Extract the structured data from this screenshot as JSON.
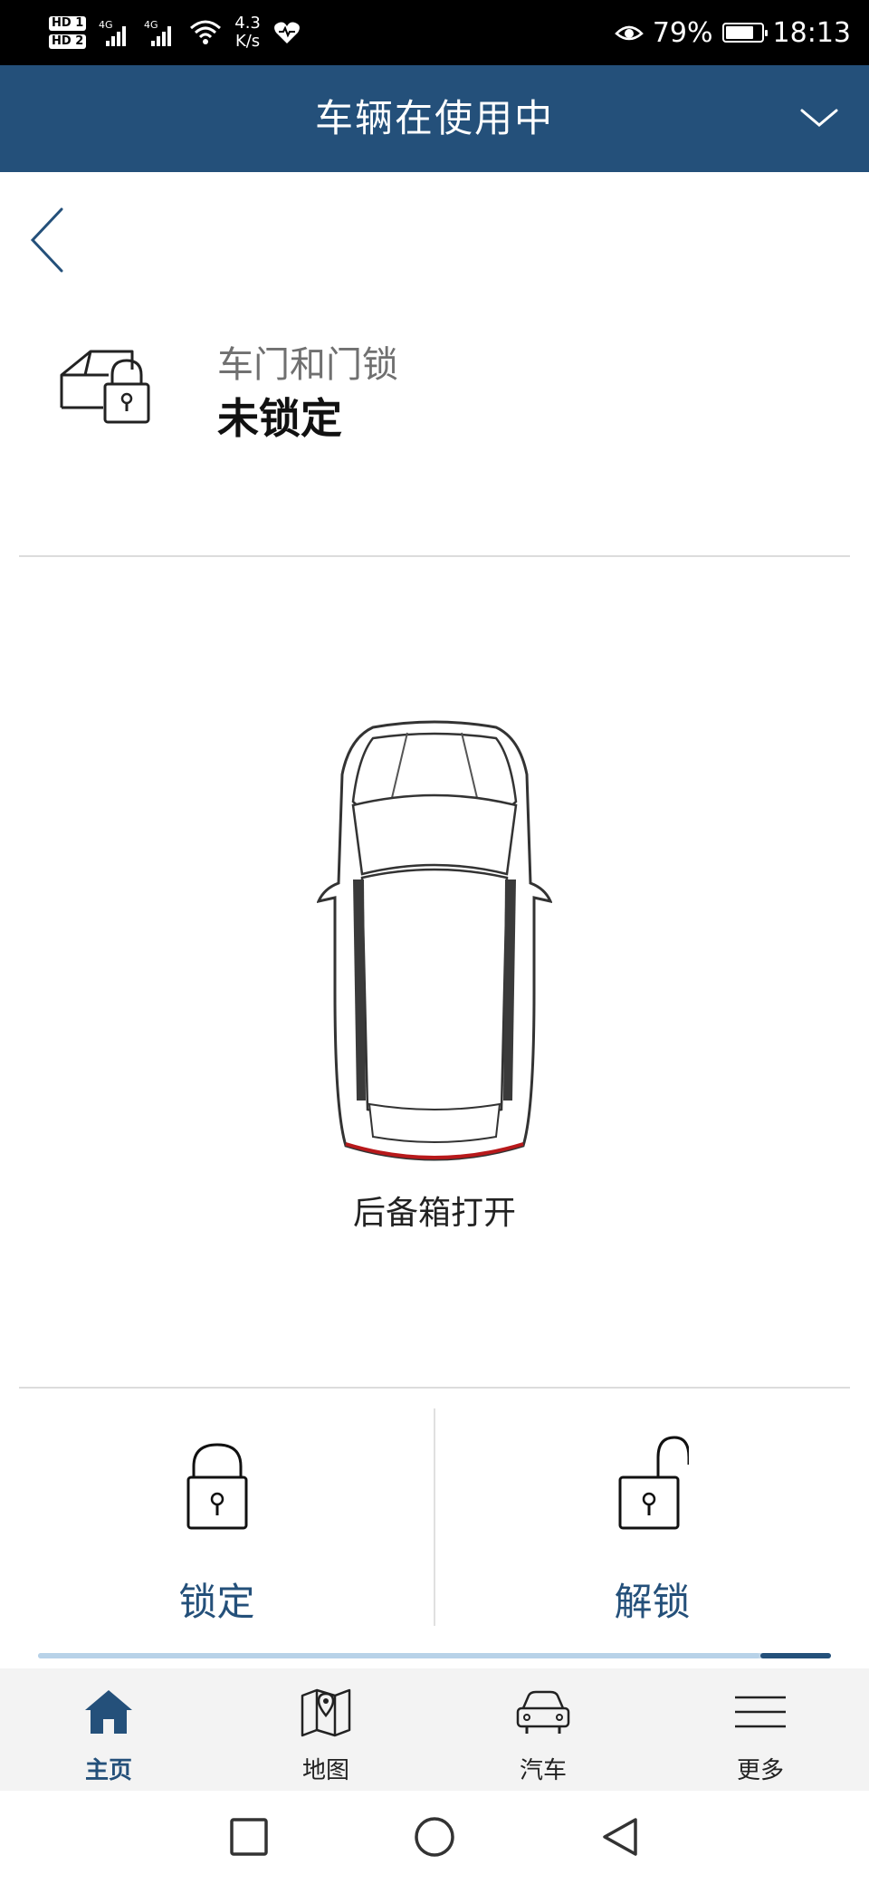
{
  "status_bar": {
    "sim1": "HD 1",
    "sim2": "HD 2",
    "signal_label_1": "4G",
    "signal_label_2": "4G",
    "net_speed_value": "4.3",
    "net_speed_unit": "K/s",
    "battery_percent": "79%",
    "battery_level": 0.79,
    "time": "18:13",
    "icons": [
      "signal-icon",
      "signal-icon",
      "wifi-icon",
      "heart-rate-icon",
      "eye-comfort-icon",
      "battery-icon"
    ]
  },
  "header": {
    "title": "车辆在使用中",
    "dropdown_icon": "chevron-down-icon"
  },
  "back_icon": "chevron-left-icon",
  "lock_status": {
    "icon": "car-door-lock-icon",
    "label": "车门和门锁",
    "value": "未锁定"
  },
  "vehicle": {
    "image": "car-top-view",
    "trunk_status": "后备箱打开",
    "highlight_color": "#b8191b"
  },
  "actions": [
    {
      "label": "锁定",
      "icon": "lock-closed-icon"
    },
    {
      "label": "解锁",
      "icon": "lock-open-icon"
    }
  ],
  "scroll_indicator": {
    "position": 0.91
  },
  "bottom_nav": [
    {
      "label": "主页",
      "icon": "home-icon",
      "active": true
    },
    {
      "label": "地图",
      "icon": "map-icon",
      "active": false
    },
    {
      "label": "汽车",
      "icon": "car-icon",
      "active": false
    },
    {
      "label": "更多",
      "icon": "menu-icon",
      "active": false
    }
  ],
  "system_nav": [
    "recent-apps-icon",
    "home-circle-icon",
    "back-triangle-icon"
  ],
  "colors": {
    "brand": "#24507a",
    "status_bar": "#000000",
    "nav_background": "#f3f3f3"
  }
}
